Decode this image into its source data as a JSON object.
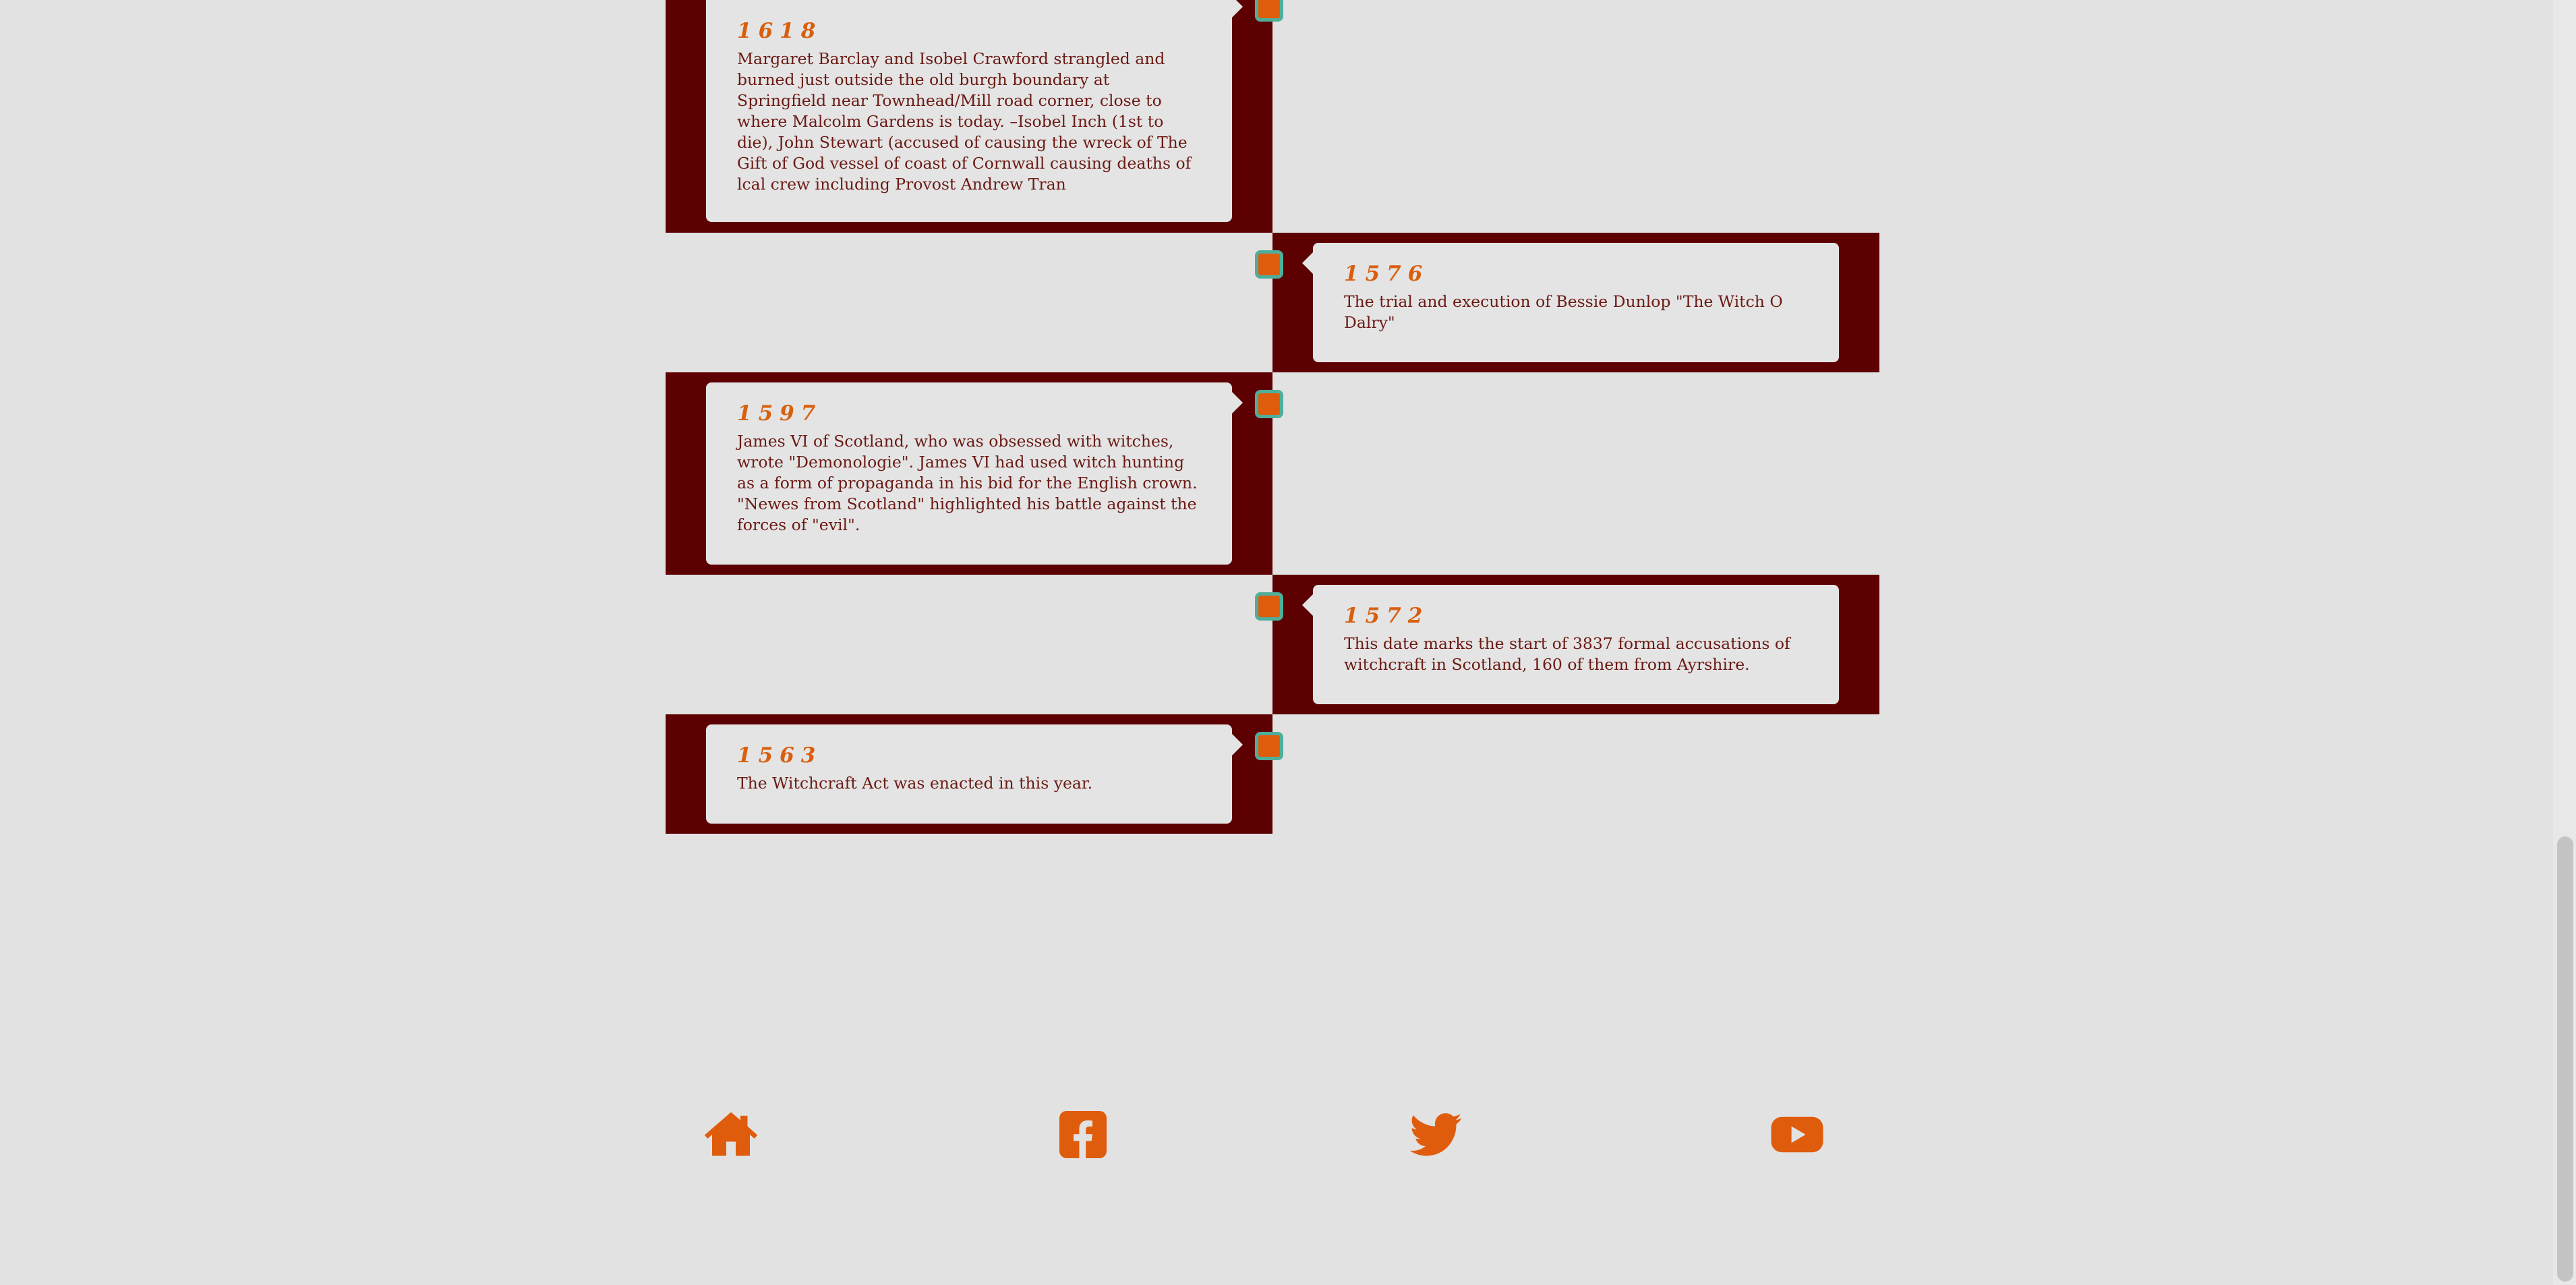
{
  "timeline": {
    "events": [
      {
        "year": "1618",
        "text": "Margaret Barclay and Isobel Crawford strangled and burned just outside the old burgh boundary at Springfield near Townhead/Mill road corner, close to where Malcolm Gardens is today. –Isobel Inch (1st to die), John Stewart (accused of causing the wreck of The Gift of God vessel of coast of Cornwall causing deaths of lcal crew including Provost Andrew Tran"
      },
      {
        "year": "1576",
        "text": "The trial and execution of Bessie Dunlop \"The Witch O Dalry\""
      },
      {
        "year": "1597",
        "text": "James VI of Scotland, who was obsessed with witches, wrote \"Demonologie\". James VI had used witch hunting as a form of propaganda in his bid for the English crown. \"Newes from Scotland\" highlighted his battle against the forces of \"evil\"."
      },
      {
        "year": "1572",
        "text": "This date marks the start of 3837 formal accusations of witchcraft in Scotland, 160 of them from Ayrshire."
      },
      {
        "year": "1563",
        "text": "The Witchcraft Act was enacted in this year."
      }
    ]
  },
  "footer": {
    "icons": [
      "home-icon",
      "facebook-icon",
      "twitter-icon",
      "youtube-icon"
    ],
    "color": "#e05c0d"
  },
  "colors": {
    "band": "#5c0002",
    "card": "#e4e4e4",
    "year": "#d95f0e",
    "text": "#6b1a14",
    "marker_fill": "#e05c0d",
    "marker_border": "#4fae9a",
    "background": "#e2e2e2"
  }
}
